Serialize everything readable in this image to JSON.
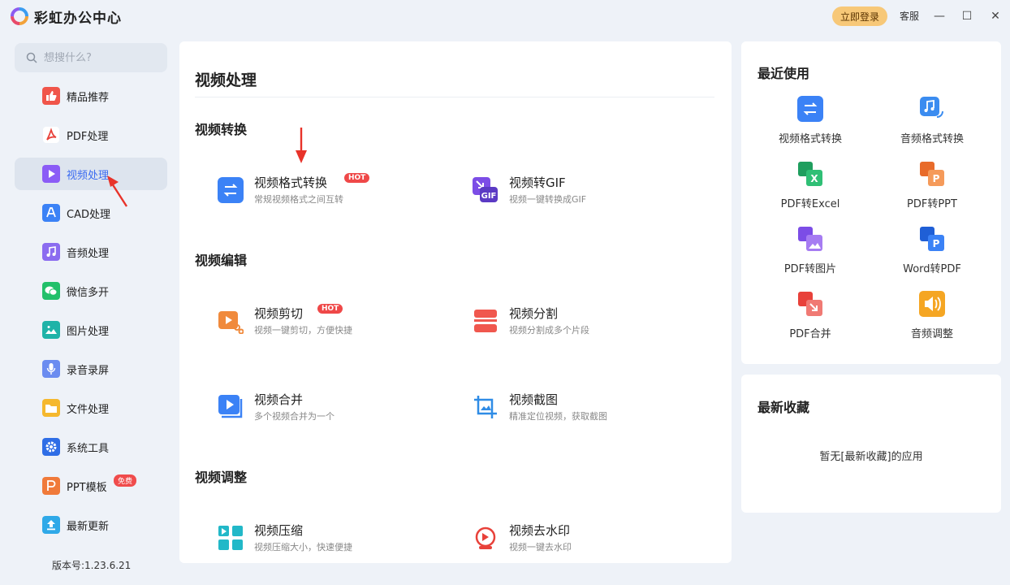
{
  "app": {
    "title": "彩虹办公中心"
  },
  "titlebar": {
    "login": "立即登录",
    "service": "客服",
    "minimize": "—",
    "maximize": "☐",
    "close": "✕"
  },
  "search": {
    "placeholder": "想搜什么?"
  },
  "nav": {
    "items": [
      {
        "label": "精品推荐",
        "icon": "thumb-up-icon",
        "color": "#f0554a"
      },
      {
        "label": "PDF处理",
        "icon": "pdf-icon",
        "color": "#ffffff"
      },
      {
        "label": "视频处理",
        "icon": "video-play-icon",
        "color": "#8b5cf6"
      },
      {
        "label": "CAD处理",
        "icon": "cad-icon",
        "color": "#3b82f6"
      },
      {
        "label": "音频处理",
        "icon": "music-icon",
        "color": "#8b6cf0"
      },
      {
        "label": "微信多开",
        "icon": "wechat-icon",
        "color": "#22c06a"
      },
      {
        "label": "图片处理",
        "icon": "image-icon",
        "color": "#1fb3a8"
      },
      {
        "label": "录音录屏",
        "icon": "microphone-icon",
        "color": "#6b8cf0"
      },
      {
        "label": "文件处理",
        "icon": "folder-icon",
        "color": "#f5b82e"
      },
      {
        "label": "系统工具",
        "icon": "gear-icon",
        "color": "#2f6ee6"
      },
      {
        "label": "PPT模板",
        "icon": "ppt-icon",
        "color": "#f07a3a"
      },
      {
        "label": "最新更新",
        "icon": "upload-icon",
        "color": "#2fa9e8"
      }
    ],
    "free_badge": "免费",
    "version": "版本号:1.23.6.21"
  },
  "main": {
    "title": "视频处理",
    "sections": [
      {
        "title": "视频转换"
      },
      {
        "title": "视频编辑"
      },
      {
        "title": "视频调整"
      }
    ],
    "tools": [
      {
        "name": "视频格式转换",
        "desc": "常规视频格式之间互转",
        "hot": "HOT",
        "icon": "swap-arrows-icon"
      },
      {
        "name": "视频转GIF",
        "desc": "视频一键转换成GIF",
        "icon": "gif-icon"
      },
      {
        "name": "视频剪切",
        "desc": "视频一键剪切，方便快捷",
        "hot": "HOT",
        "icon": "video-cut-icon"
      },
      {
        "name": "视频分割",
        "desc": "视频分割成多个片段",
        "icon": "video-split-icon"
      },
      {
        "name": "视频合并",
        "desc": "多个视频合并为一个",
        "icon": "video-merge-icon"
      },
      {
        "name": "视频截图",
        "desc": "精准定位视频，获取截图",
        "icon": "crop-image-icon"
      },
      {
        "name": "视频压缩",
        "desc": "视频压缩大小，快速便捷",
        "icon": "compress-icon"
      },
      {
        "name": "视频去水印",
        "desc": "视频一键去水印",
        "icon": "watermark-remove-icon"
      }
    ]
  },
  "recent": {
    "title": "最近使用",
    "items": [
      {
        "label": "视频格式转换",
        "icon": "swap-arrows-icon"
      },
      {
        "label": "音频格式转换",
        "icon": "music-convert-icon"
      },
      {
        "label": "PDF转Excel",
        "icon": "pdf-excel-icon"
      },
      {
        "label": "PDF转PPT",
        "icon": "pdf-ppt-icon"
      },
      {
        "label": "PDF转图片",
        "icon": "pdf-image-icon"
      },
      {
        "label": "Word转PDF",
        "icon": "word-pdf-icon"
      },
      {
        "label": "PDF合并",
        "icon": "pdf-merge-icon"
      },
      {
        "label": "音频调整",
        "icon": "speaker-icon"
      }
    ]
  },
  "favorites": {
    "title": "最新收藏",
    "empty": "暂无[最新收藏]的应用"
  }
}
